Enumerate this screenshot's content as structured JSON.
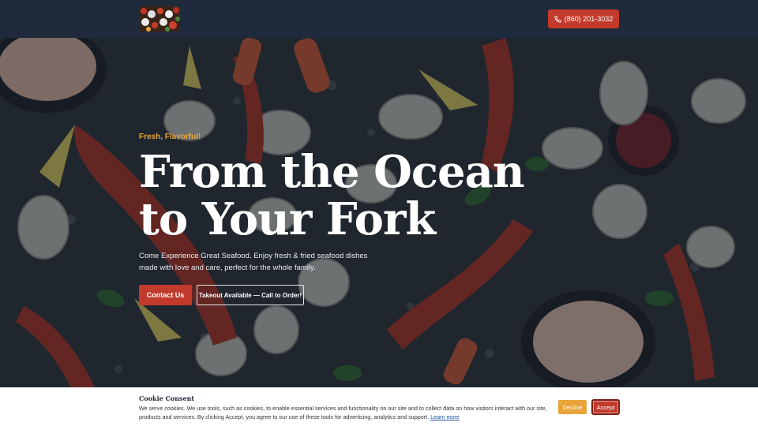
{
  "header": {
    "logo_alt": "restaurant logo",
    "phone_label": "(860) 201-3032",
    "phone_icon": "phone-icon"
  },
  "hero": {
    "tagline": "Fresh, Flavorful!",
    "title_line1": "From the Ocean",
    "title_line2": "to Your Fork",
    "description": "Come Experience Great Seafood. Enjoy fresh & fried seafood dishes made with love and care, perfect for the whole family.",
    "contact_button": "Contact Us",
    "takeout_button": "Takeout Available — Call to Order!"
  },
  "cookie_consent": {
    "title": "Cookie Consent",
    "text": "We serve cookies. We use tools, such as cookies, to enable essential services and functionality on our site and to collect data on how visitors interact with our site, products and services. By clicking Accept, you agree to our use of these tools for advertising, analytics and support.",
    "learn_more": "Learn more",
    "decline_button": "Decline",
    "accept_button": "Accept"
  },
  "colors": {
    "header_bg": "#1f2b3c",
    "accent_red": "#c23a2b",
    "accent_orange": "#e8a43a"
  }
}
